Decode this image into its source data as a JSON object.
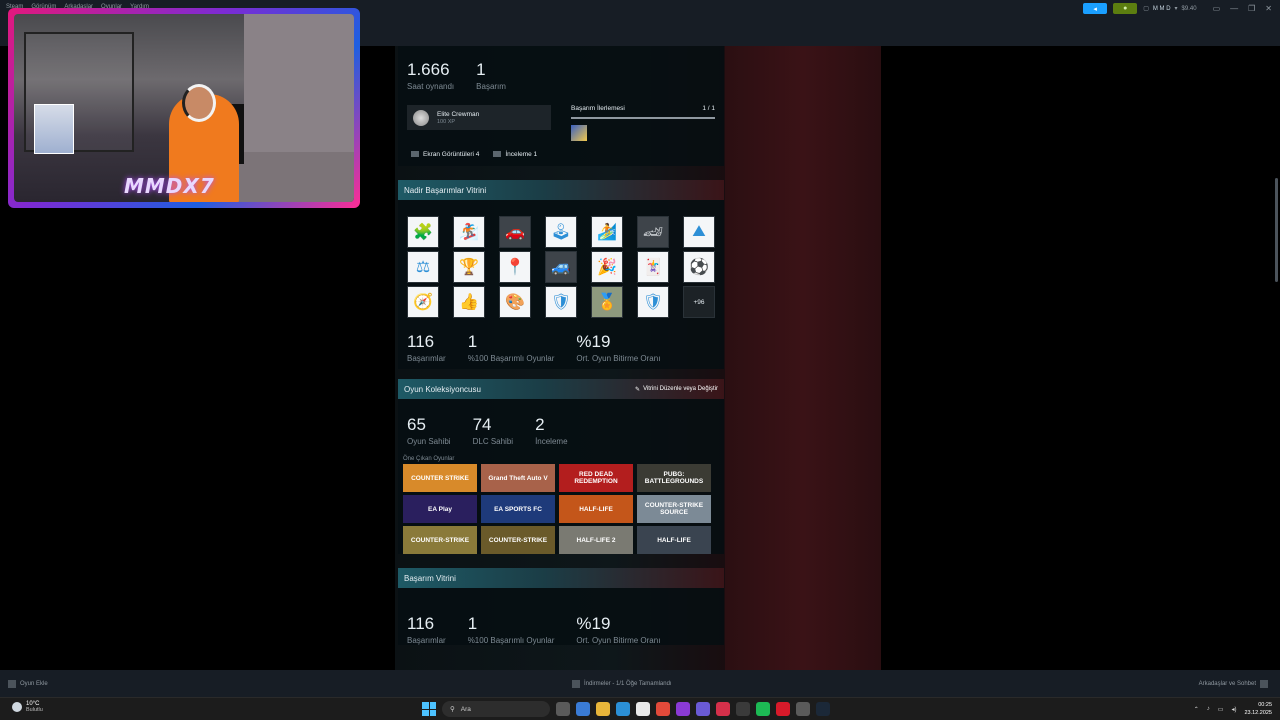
{
  "menu": [
    "Steam",
    "Görünüm",
    "Arkadaşlar",
    "Oyunlar",
    "Yardım"
  ],
  "account": {
    "name": "M M D",
    "wallet": "$9.40"
  },
  "webcam": {
    "logo": "MMDX7"
  },
  "profile": {
    "hours": "1.666",
    "hours_label": "Saat oynandı",
    "achievements": "1",
    "achievements_label": "Başarım",
    "badge": {
      "name": "Elite Crewman",
      "xp": "100 XP"
    },
    "progress": {
      "label": "Başarım İlerlemesi",
      "count": "1 / 1",
      "fraction": 1.0
    },
    "screenshots": "Ekran Görüntüleri 4",
    "reviews": "İnceleme 1"
  },
  "rare": {
    "title": "Nadir Başarımlar Vitrini",
    "icons": [
      "🧩",
      "🏂",
      "🚗",
      "🕹",
      "🏄",
      "🏎",
      "⛰",
      "⚖",
      "🏆",
      "📍",
      "🚙",
      "🎉",
      "🃏",
      "⚽",
      "🧭",
      "👍",
      "🎨",
      "🛡",
      "🏅",
      "🛡"
    ],
    "more": "+96",
    "stats": [
      {
        "num": "116",
        "lbl": "Başarımlar"
      },
      {
        "num": "1",
        "lbl": "%100 Başarımlı Oyunlar"
      },
      {
        "num": "%19",
        "lbl": "Ort. Oyun Bitirme Oranı"
      }
    ]
  },
  "collector": {
    "title": "Oyun Koleksiyoncusu",
    "edit": "Vitrini Düzenle veya Değiştir",
    "stats": [
      {
        "num": "65",
        "lbl": "Oyun Sahibi"
      },
      {
        "num": "74",
        "lbl": "DLC Sahibi"
      },
      {
        "num": "2",
        "lbl": "İnceleme"
      }
    ],
    "featured_label": "Öne Çıkan Oyunlar",
    "games": [
      {
        "name": "COUNTER STRIKE",
        "bg": "#d88a2a"
      },
      {
        "name": "Grand Theft Auto V",
        "bg": "#a8624a"
      },
      {
        "name": "RED DEAD REDEMPTION",
        "bg": "#b31e1e"
      },
      {
        "name": "PUBG: BATTLEGROUNDS",
        "bg": "#3b3b34"
      },
      {
        "name": "EA Play",
        "bg": "#2a1f5e"
      },
      {
        "name": "EA SPORTS FC",
        "bg": "#1e3a7a"
      },
      {
        "name": "HALF-LIFE",
        "bg": "#c4561a"
      },
      {
        "name": "COUNTER-STRIKE SOURCE",
        "bg": "#7c8a96"
      },
      {
        "name": "COUNTER-STRIKE",
        "bg": "#8a7a3a"
      },
      {
        "name": "COUNTER-STRIKE",
        "bg": "#6a5a2a"
      },
      {
        "name": "HALF-LIFE 2",
        "bg": "#7a7a72"
      },
      {
        "name": "HALF-LIFE",
        "bg": "#3a4450"
      }
    ]
  },
  "ach_showcase": {
    "title": "Başarım Vitrini",
    "stats": [
      {
        "num": "116",
        "lbl": "Başarımlar"
      },
      {
        "num": "1",
        "lbl": "%100 Başarımlı Oyunlar"
      },
      {
        "num": "%19",
        "lbl": "Ort. Oyun Bitirme Oranı"
      }
    ]
  },
  "bottombar": {
    "add_game": "Oyun Ekle",
    "downloads": "İndirmeler - 1/1 Öğe Tamamlandı",
    "friends": "Arkadaşlar ve Sohbet"
  },
  "taskbar": {
    "temp": "10°C",
    "weather": "Bulutlu",
    "search": "Ara",
    "time": "00:25",
    "date": "23.12.2025"
  }
}
